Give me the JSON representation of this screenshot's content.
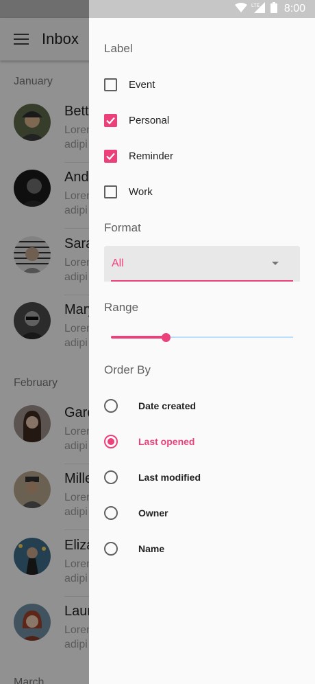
{
  "status_bar": {
    "time": "8:00",
    "network": "LTE"
  },
  "app_bar": {
    "title": "Inbox"
  },
  "inbox": {
    "months": [
      "January",
      "February",
      "March"
    ],
    "messages": [
      {
        "name": "Bett",
        "line1": "Lorem",
        "line2": "adipi"
      },
      {
        "name": "Andr",
        "line1": "Lorem",
        "line2": "adipi"
      },
      {
        "name": "Sara",
        "line1": "Lorem",
        "line2": "adipi"
      },
      {
        "name": "Mary",
        "line1": "Lorem",
        "line2": "adipi"
      },
      {
        "name": "Gard",
        "line1": "Lorem",
        "line2": "adipi"
      },
      {
        "name": "Mille",
        "line1": "Lorem",
        "line2": "adipi"
      },
      {
        "name": "Eliza",
        "line1": "Lorem",
        "line2": "adipi"
      },
      {
        "name": "Laur",
        "line1": "Lorem",
        "line2": "adipi"
      }
    ]
  },
  "filters": {
    "label_section": "Label",
    "labels": [
      {
        "text": "Event",
        "checked": false
      },
      {
        "text": "Personal",
        "checked": true
      },
      {
        "text": "Reminder",
        "checked": true
      },
      {
        "text": "Work",
        "checked": false
      }
    ],
    "format_section": "Format",
    "format_value": "All",
    "range_section": "Range",
    "range_value": 0.3,
    "order_section": "Order By",
    "order_options": [
      {
        "text": "Date created",
        "selected": false
      },
      {
        "text": "Last opened",
        "selected": true
      },
      {
        "text": "Last modified",
        "selected": false
      },
      {
        "text": "Owner",
        "selected": false
      },
      {
        "text": "Name",
        "selected": false
      }
    ]
  },
  "colors": {
    "accent": "#ec407a",
    "slider_track": "#bbdefb"
  }
}
